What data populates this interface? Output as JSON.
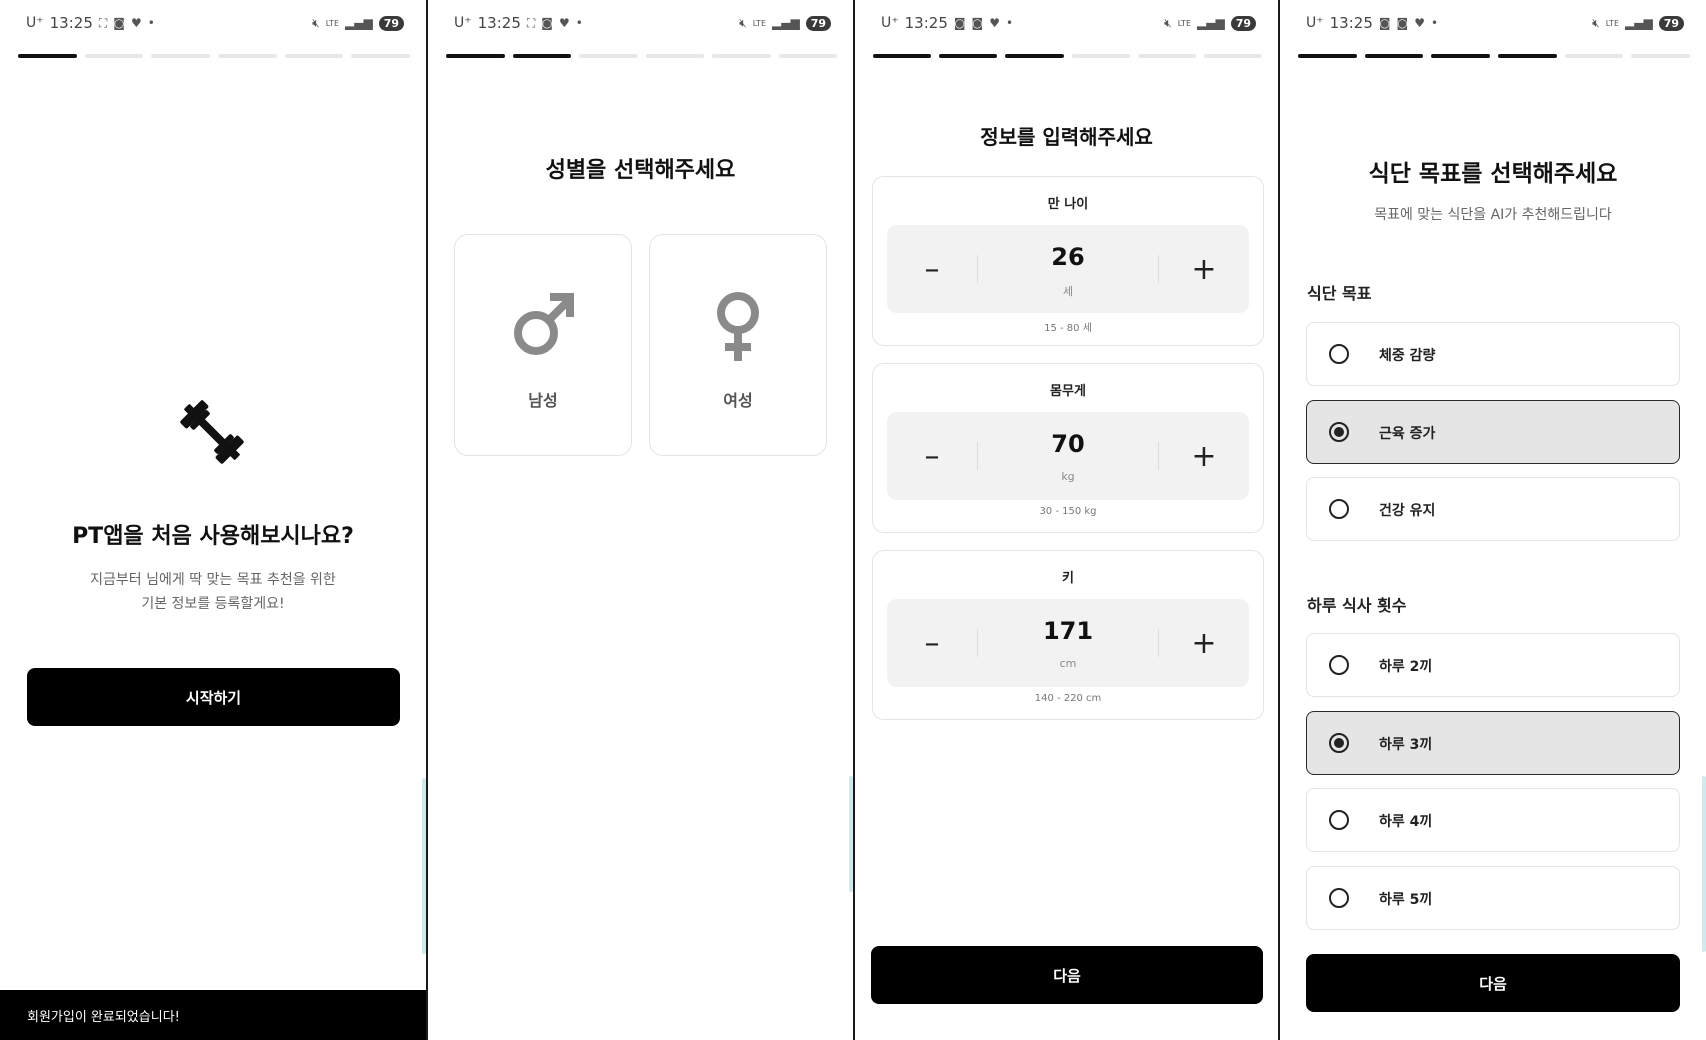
{
  "status_bar": {
    "carrier": "U⁺",
    "time": "13:25",
    "network": "LTE",
    "battery": "79"
  },
  "screen1": {
    "title": "PT앱을 처음 사용해보시나요?",
    "subtitle_line1": "지금부터 님에게 딱 맞는 목표 추천을 위한",
    "subtitle_line2": "기본 정보를 등록할게요!",
    "start_button": "시작하기",
    "toast": "회원가입이 완료되었습니다!",
    "progress_step": 1,
    "progress_total": 6
  },
  "screen2": {
    "title": "성별을 선택해주세요",
    "options": [
      {
        "label": "남성",
        "icon": "male-icon"
      },
      {
        "label": "여성",
        "icon": "female-icon"
      }
    ],
    "progress_step": 2,
    "progress_total": 6
  },
  "screen3": {
    "title": "정보를 입력해주세요",
    "fields": [
      {
        "label": "만 나이",
        "value": "26",
        "unit": "세",
        "range": "15 - 80 세"
      },
      {
        "label": "몸무게",
        "value": "70",
        "unit": "kg",
        "range": "30 - 150 kg"
      },
      {
        "label": "키",
        "value": "171",
        "unit": "cm",
        "range": "140 - 220 cm"
      }
    ],
    "minus_symbol": "–",
    "plus_symbol": "+",
    "next_button": "다음",
    "progress_step": 3,
    "progress_total": 6
  },
  "screen4": {
    "title": "식단 목표를 선택해주세요",
    "subtitle": "목표에 맞는 식단을 AI가 추천해드립니다",
    "goal_section_label": "식단 목표",
    "goals": [
      {
        "label": "체중 감량",
        "selected": false
      },
      {
        "label": "근육 증가",
        "selected": true
      },
      {
        "label": "건강 유지",
        "selected": false
      }
    ],
    "meals_section_label": "하루 식사 횟수",
    "meals": [
      {
        "label": "하루 2끼",
        "selected": false
      },
      {
        "label": "하루 3끼",
        "selected": true
      },
      {
        "label": "하루 4끼",
        "selected": false
      },
      {
        "label": "하루 5끼",
        "selected": false
      }
    ],
    "next_button": "다음",
    "progress_step": 4,
    "progress_total": 6
  }
}
